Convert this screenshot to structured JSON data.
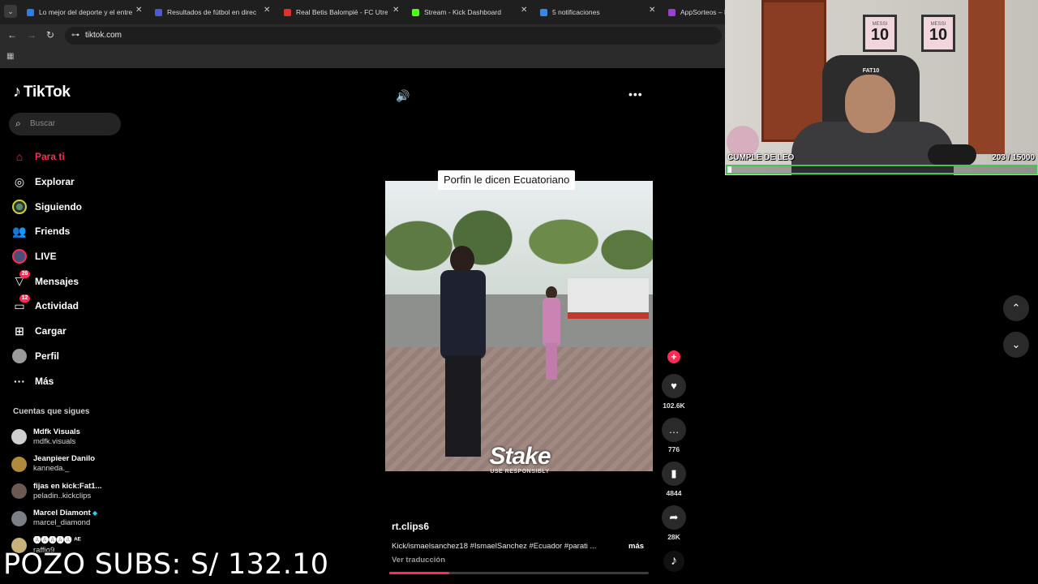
{
  "browser": {
    "tabs": [
      {
        "title": "Lo mejor del deporte y el entre",
        "color": "#2f7be8"
      },
      {
        "title": "Resultados de fútbol en directo",
        "color": "#4a5bd6"
      },
      {
        "title": "Real Betis Balompié - FC Utrech",
        "color": "#e2312a"
      },
      {
        "title": "Stream - Kick Dashboard",
        "color": "#53fc18"
      },
      {
        "title": "5 notificaciones",
        "color": "#3a86e0"
      },
      {
        "title": "AppSorteos – Li",
        "color": "#9c3fd1"
      }
    ],
    "url": "tiktok.com"
  },
  "tiktok": {
    "logo": "TikTok",
    "search_placeholder": "Buscar",
    "nav": [
      {
        "label": "Para ti",
        "icon": "home-icon",
        "glyph": "⌂",
        "active": true
      },
      {
        "label": "Explorar",
        "icon": "compass-icon",
        "glyph": "◎"
      },
      {
        "label": "Siguiendo",
        "icon": "following-avatar-icon",
        "glyph": ""
      },
      {
        "label": "Friends",
        "icon": "friends-icon",
        "glyph": "👥"
      },
      {
        "label": "LIVE",
        "icon": "live-icon",
        "glyph": ""
      },
      {
        "label": "Mensajes",
        "icon": "messages-icon",
        "glyph": "▽",
        "badge": "26"
      },
      {
        "label": "Actividad",
        "icon": "activity-icon",
        "glyph": "▭",
        "badge": "12"
      },
      {
        "label": "Cargar",
        "icon": "upload-icon",
        "glyph": "⊞"
      },
      {
        "label": "Perfil",
        "icon": "profile-avatar-icon",
        "glyph": ""
      },
      {
        "label": "Más",
        "icon": "more-icon",
        "glyph": "···"
      }
    ],
    "following_title": "Cuentas que sigues",
    "following": [
      {
        "name": "Mdfk Visuals",
        "user": "mdfk.visuals",
        "avatar": "#cfcfcf"
      },
      {
        "name": "Jeanpieer Danilo",
        "user": "kanneda._",
        "avatar": "#b08a3c"
      },
      {
        "name": "fijas en kick:Fat1...",
        "user": "peladin..kickclips",
        "avatar": "#6c5a52"
      },
      {
        "name": "Marcel Diamont",
        "user": "marcel_diamond",
        "avatar": "#7d7f86",
        "verified": true
      },
      {
        "name": "🅐🅐🅐🅐🅐 ᴬᴱ",
        "user": "raffio9",
        "avatar": "#c7b27a"
      }
    ],
    "video": {
      "caption_tag": "Porfin le dicen Ecuatoriano",
      "watermark": "Stake",
      "watermark_sub": "USE RESPONSIBLY",
      "author": "rt.clips6",
      "description": "Kick/ismaelsanchez18 #IsmaelSanchez #Ecuador #parati ...",
      "more": "más",
      "translate": "Ver traducción",
      "progress": 0.23
    },
    "actions": {
      "likes": "102.6K",
      "comments": "776",
      "saves": "4844",
      "shares": "28K"
    }
  },
  "webcam": {
    "chair_label": "FAT10",
    "jersey_name": "MESSI",
    "jersey_number": "10",
    "goal_label": "CUMPLE DE LEO",
    "goal_count": "203 / 15000",
    "goal_progress": 0.0135
  },
  "overlay": {
    "pozo_text": "POZO SUBS: S/ 132.10"
  }
}
